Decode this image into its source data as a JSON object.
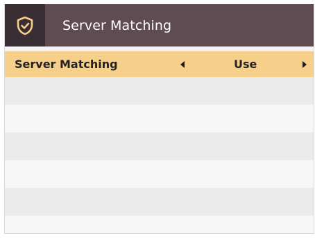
{
  "header": {
    "title": "Server Matching",
    "icon": "shield-check-icon"
  },
  "settings": {
    "server_matching": {
      "label": "Server Matching",
      "value": "Use"
    }
  },
  "theme": {
    "header_bg": "#5e4c52",
    "icon_bg": "#3a2d33",
    "selected_row_bg": "#f6cf8b"
  }
}
